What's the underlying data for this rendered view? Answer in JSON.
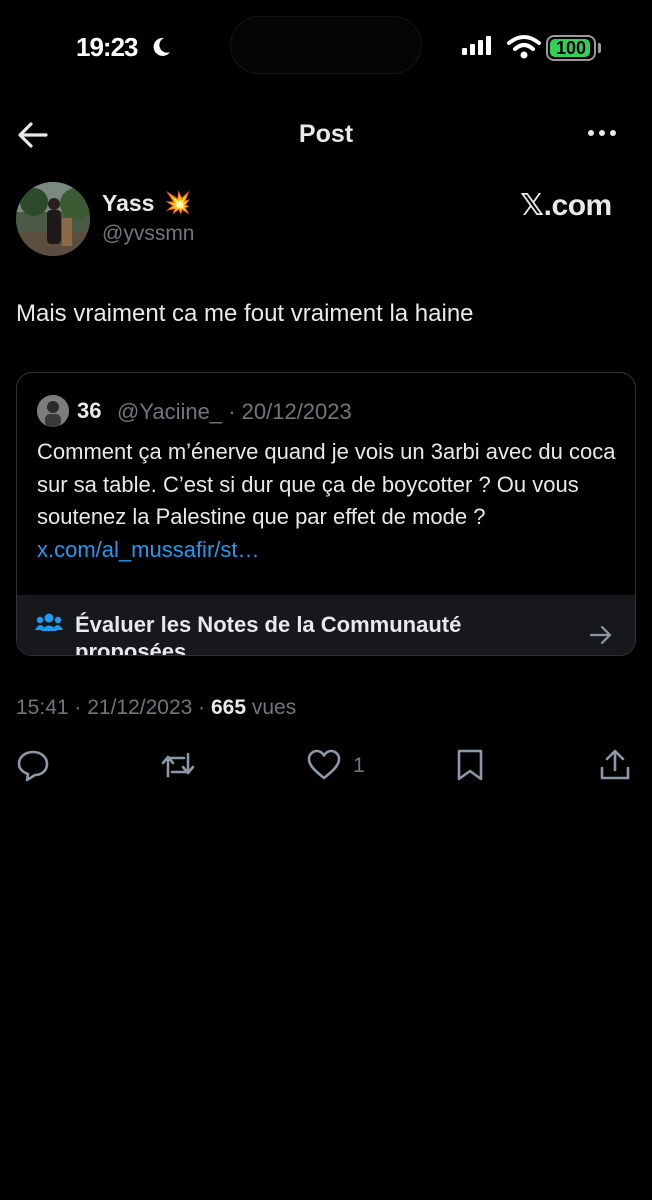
{
  "status_bar": {
    "time": "19:23",
    "battery": "100"
  },
  "header": {
    "title": "Post"
  },
  "author": {
    "name": "Yass",
    "name_emoji": "💥",
    "handle": "@yvssmn"
  },
  "brand": {
    "label": "𝕏.com"
  },
  "tweet": {
    "text": "Mais vraiment ca me fout vraiment la haine"
  },
  "quote": {
    "name": "36",
    "handle_date": "@Yaciine_ · 20/12/2023",
    "text": "Comment ça m’énerve quand je vois un 3arbi avec du coca sur sa table. C’est si dur que ça de boycotter ? Ou vous soutenez la Palestine que par effet de mode ? ",
    "link": "x.com/al_mussafir/st…",
    "notes_label": "Évaluer les Notes de la Communauté proposées"
  },
  "meta": {
    "time_date": "15:41 · 21/12/2023 · ",
    "views_count": "665",
    "views_label": " vues"
  },
  "actions": {
    "like_count": "1"
  },
  "icons": {
    "back": "back-arrow-icon",
    "more": "more-icon",
    "moon": "moon-icon",
    "reply": "reply-icon",
    "repost": "repost-icon",
    "like": "heart-icon",
    "bookmark": "bookmark-icon",
    "share": "share-icon",
    "people": "people-icon"
  },
  "colors": {
    "background": "#000000",
    "text": "#e7e9ea",
    "muted": "#71767b",
    "link": "#1d9bf0",
    "battery": "#31d158"
  }
}
